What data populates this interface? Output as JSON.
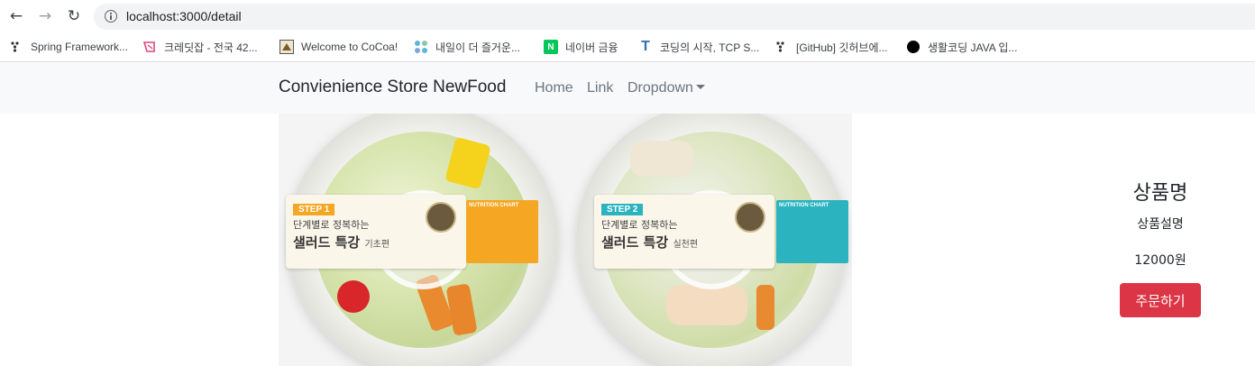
{
  "browser": {
    "url": "localhost:3000/detail",
    "back_glyph": "←",
    "forward_glyph": "→",
    "reload_glyph": "↻"
  },
  "bookmarks": [
    {
      "label": "Spring Framework...",
      "icon": "spring-icon"
    },
    {
      "label": "크레딧잡 - 전국 42...",
      "icon": "kreditjob-icon"
    },
    {
      "label": "Welcome to CoCoa!",
      "icon": "cocoa-icon"
    },
    {
      "label": "내일이 더 즐거운...",
      "icon": "dots-icon"
    },
    {
      "label": "네이버 금융",
      "icon": "naver-icon"
    },
    {
      "label": "코딩의 시작, TCP S...",
      "icon": "tcp-icon"
    },
    {
      "label": "[GitHub] 깃허브에...",
      "icon": "github-icon"
    },
    {
      "label": "생활코딩 JAVA 입...",
      "icon": "opentutorials-icon"
    }
  ],
  "navbar": {
    "brand": "Convienience Store NewFood",
    "links": [
      "Home",
      "Link",
      "Dropdown"
    ]
  },
  "product": {
    "image_labels": [
      {
        "step": "STEP 1",
        "sub": "단계별로 정복하는",
        "main": "샐러드 특강",
        "tail": "기초편",
        "accent": "#f5a623",
        "chart": "NUTRITION CHART"
      },
      {
        "step": "STEP 2",
        "sub": "단계별로 정복하는",
        "main": "샐러드 특강",
        "tail": "실천편",
        "accent": "#2bb3c0",
        "chart": "NUTRITION CHART"
      }
    ],
    "name": "상품명",
    "description": "상품설명",
    "price": "12000원",
    "order_button": "주문하기"
  },
  "colors": {
    "navbar_bg": "#f8f9fa",
    "order_button": "#dc3545"
  }
}
